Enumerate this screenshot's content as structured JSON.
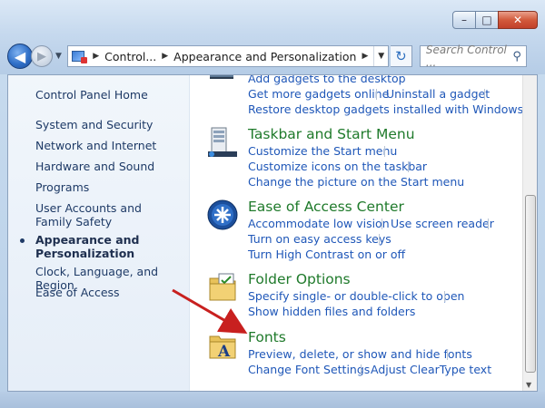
{
  "window": {
    "caption": {
      "minimize_glyph": "–",
      "maximize_glyph": "□",
      "close_glyph": "✕"
    }
  },
  "nav": {
    "back_glyph": "◀",
    "forward_glyph": "▶",
    "recent_glyph": "▼",
    "breadcrumbs": [
      "Control...",
      "Appearance and Personalization"
    ],
    "refresh_glyph": "↻",
    "search_placeholder": "Search Control ...",
    "search_glyph": "⚲"
  },
  "sidebar": {
    "home": "Control Panel Home",
    "items": [
      {
        "label": "System and Security"
      },
      {
        "label": "Network and Internet"
      },
      {
        "label": "Hardware and Sound"
      },
      {
        "label": "Programs"
      },
      {
        "label": "User Accounts and Family Safety"
      },
      {
        "label": "Appearance and Personalization",
        "current": true
      },
      {
        "label": "Clock, Language, and Region"
      },
      {
        "label": "Ease of Access"
      }
    ]
  },
  "main": {
    "gadgets": {
      "tasks": [
        "Add gadgets to the desktop",
        "Get more gadgets online",
        "Uninstall a gadget",
        "Restore desktop gadgets installed with Windows"
      ]
    },
    "taskbar": {
      "title": "Taskbar and Start Menu",
      "tasks": [
        "Customize the Start menu",
        "Customize icons on the taskbar",
        "Change the picture on the Start menu"
      ]
    },
    "ease": {
      "title": "Ease of Access Center",
      "tasks": [
        "Accommodate low vision",
        "Use screen reader",
        "Turn on easy access keys",
        "Turn High Contrast on or off"
      ]
    },
    "folder": {
      "title": "Folder Options",
      "tasks": [
        "Specify single- or double-click to open",
        "Show hidden files and folders"
      ]
    },
    "fonts": {
      "title": "Fonts",
      "tasks": [
        "Preview, delete, or show and hide fonts",
        "Change Font Settings",
        "Adjust ClearType text"
      ]
    }
  },
  "colors": {
    "category_title": "#1f7a2b",
    "task_link": "#1f57b8",
    "sidebar_link": "#1e3a66",
    "annotation_arrow": "#c8201f"
  }
}
